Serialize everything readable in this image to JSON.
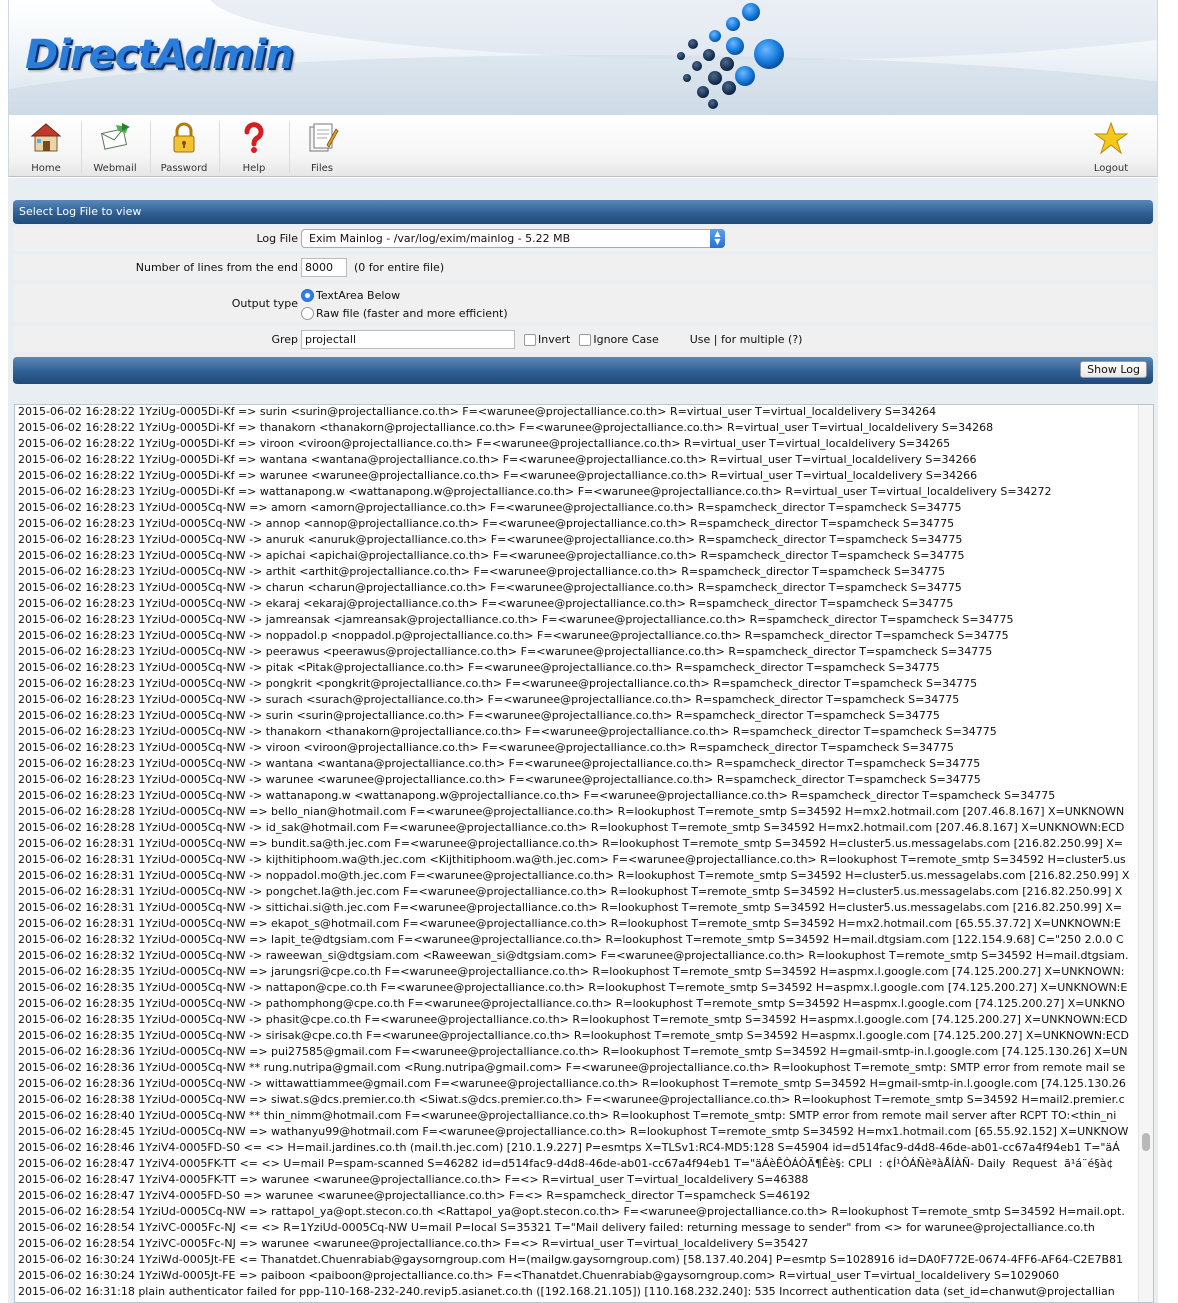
{
  "brand": {
    "name": "DirectAdmin"
  },
  "toolbar": {
    "home": "Home",
    "webmail": "Webmail",
    "password": "Password",
    "help": "Help",
    "files": "Files",
    "logout": "Logout"
  },
  "section": {
    "title": "Select Log File to view"
  },
  "form": {
    "log_file_label": "Log File",
    "log_file_value": "Exim Mainlog - /var/log/exim/mainlog - 5.22 MB",
    "lines_label": "Number of lines from the end",
    "lines_value": "8000",
    "lines_hint": "(0 for entire file)",
    "output_label": "Output type",
    "output_opt1": "TextArea Below",
    "output_opt2": "Raw file (faster and more efficient)",
    "output_selected": "TextArea Below",
    "grep_label": "Grep",
    "grep_value": "projectall",
    "invert_label": "Invert",
    "ignore_case_label": "Ignore Case",
    "use_hint": "Use | for multiple (?)",
    "show_log_button": "Show Log"
  },
  "colors": {
    "accent": "#2f5f93",
    "logo": "#2a7dd8",
    "panel": "#e9eef3"
  },
  "log_lines": [
    "2015-06-02 16:28:22 1YziUg-0005Di-Kf => surin <surin@projectalliance.co.th> F=<warunee@projectalliance.co.th> R=virtual_user T=virtual_localdelivery S=34264",
    "2015-06-02 16:28:22 1YziUg-0005Di-Kf => thanakorn <thanakorn@projectalliance.co.th> F=<warunee@projectalliance.co.th> R=virtual_user T=virtual_localdelivery S=34268",
    "2015-06-02 16:28:22 1YziUg-0005Di-Kf => viroon <viroon@projectalliance.co.th> F=<warunee@projectalliance.co.th> R=virtual_user T=virtual_localdelivery S=34265",
    "2015-06-02 16:28:22 1YziUg-0005Di-Kf => wantana <wantana@projectalliance.co.th> F=<warunee@projectalliance.co.th> R=virtual_user T=virtual_localdelivery S=34266",
    "2015-06-02 16:28:22 1YziUg-0005Di-Kf => warunee <warunee@projectalliance.co.th> F=<warunee@projectalliance.co.th> R=virtual_user T=virtual_localdelivery S=34266",
    "2015-06-02 16:28:23 1YziUg-0005Di-Kf => wattanapong.w <wattanapong.w@projectalliance.co.th> F=<warunee@projectalliance.co.th> R=virtual_user T=virtual_localdelivery S=34272",
    "2015-06-02 16:28:23 1YziUd-0005Cq-NW => amorn <amorn@projectalliance.co.th> F=<warunee@projectalliance.co.th> R=spamcheck_director T=spamcheck S=34775",
    "2015-06-02 16:28:23 1YziUd-0005Cq-NW -> annop <annop@projectalliance.co.th> F=<warunee@projectalliance.co.th> R=spamcheck_director T=spamcheck S=34775",
    "2015-06-02 16:28:23 1YziUd-0005Cq-NW -> anuruk <anuruk@projectalliance.co.th> F=<warunee@projectalliance.co.th> R=spamcheck_director T=spamcheck S=34775",
    "2015-06-02 16:28:23 1YziUd-0005Cq-NW -> apichai <apichai@projectalliance.co.th> F=<warunee@projectalliance.co.th> R=spamcheck_director T=spamcheck S=34775",
    "2015-06-02 16:28:23 1YziUd-0005Cq-NW -> arthit <arthit@projectalliance.co.th> F=<warunee@projectalliance.co.th> R=spamcheck_director T=spamcheck S=34775",
    "2015-06-02 16:28:23 1YziUd-0005Cq-NW -> charun <charun@projectalliance.co.th> F=<warunee@projectalliance.co.th> R=spamcheck_director T=spamcheck S=34775",
    "2015-06-02 16:28:23 1YziUd-0005Cq-NW -> ekaraj <ekaraj@projectalliance.co.th> F=<warunee@projectalliance.co.th> R=spamcheck_director T=spamcheck S=34775",
    "2015-06-02 16:28:23 1YziUd-0005Cq-NW -> jamreansak <jamreansak@projectalliance.co.th> F=<warunee@projectalliance.co.th> R=spamcheck_director T=spamcheck S=34775",
    "2015-06-02 16:28:23 1YziUd-0005Cq-NW -> noppadol.p <noppadol.p@projectalliance.co.th> F=<warunee@projectalliance.co.th> R=spamcheck_director T=spamcheck S=34775",
    "2015-06-02 16:28:23 1YziUd-0005Cq-NW -> peerawus <peerawus@projectalliance.co.th> F=<warunee@projectalliance.co.th> R=spamcheck_director T=spamcheck S=34775",
    "2015-06-02 16:28:23 1YziUd-0005Cq-NW -> pitak <Pitak@projectalliance.co.th> F=<warunee@projectalliance.co.th> R=spamcheck_director T=spamcheck S=34775",
    "2015-06-02 16:28:23 1YziUd-0005Cq-NW -> pongkrit <pongkrit@projectalliance.co.th> F=<warunee@projectalliance.co.th> R=spamcheck_director T=spamcheck S=34775",
    "2015-06-02 16:28:23 1YziUd-0005Cq-NW -> surach <surach@projectalliance.co.th> F=<warunee@projectalliance.co.th> R=spamcheck_director T=spamcheck S=34775",
    "2015-06-02 16:28:23 1YziUd-0005Cq-NW -> surin <surin@projectalliance.co.th> F=<warunee@projectalliance.co.th> R=spamcheck_director T=spamcheck S=34775",
    "2015-06-02 16:28:23 1YziUd-0005Cq-NW -> thanakorn <thanakorn@projectalliance.co.th> F=<warunee@projectalliance.co.th> R=spamcheck_director T=spamcheck S=34775",
    "2015-06-02 16:28:23 1YziUd-0005Cq-NW -> viroon <viroon@projectalliance.co.th> F=<warunee@projectalliance.co.th> R=spamcheck_director T=spamcheck S=34775",
    "2015-06-02 16:28:23 1YziUd-0005Cq-NW -> wantana <wantana@projectalliance.co.th> F=<warunee@projectalliance.co.th> R=spamcheck_director T=spamcheck S=34775",
    "2015-06-02 16:28:23 1YziUd-0005Cq-NW -> warunee <warunee@projectalliance.co.th> F=<warunee@projectalliance.co.th> R=spamcheck_director T=spamcheck S=34775",
    "2015-06-02 16:28:23 1YziUd-0005Cq-NW -> wattanapong.w <wattanapong.w@projectalliance.co.th> F=<warunee@projectalliance.co.th> R=spamcheck_director T=spamcheck S=34775",
    "2015-06-02 16:28:28 1YziUd-0005Cq-NW => bello_nian@hotmail.com F=<warunee@projectalliance.co.th> R=lookuphost T=remote_smtp S=34592 H=mx2.hotmail.com [207.46.8.167] X=UNKNOWN",
    "2015-06-02 16:28:28 1YziUd-0005Cq-NW -> id_sak@hotmail.com F=<warunee@projectalliance.co.th> R=lookuphost T=remote_smtp S=34592 H=mx2.hotmail.com [207.46.8.167] X=UNKNOWN:ECD",
    "2015-06-02 16:28:31 1YziUd-0005Cq-NW => bundit.sa@th.jec.com F=<warunee@projectalliance.co.th> R=lookuphost T=remote_smtp S=34592 H=cluster5.us.messagelabs.com [216.82.250.99] X=",
    "2015-06-02 16:28:31 1YziUd-0005Cq-NW -> kijthitiphoom.wa@th.jec.com <Kijthitiphoom.wa@th.jec.com> F=<warunee@projectalliance.co.th> R=lookuphost T=remote_smtp S=34592 H=cluster5.us",
    "2015-06-02 16:28:31 1YziUd-0005Cq-NW -> noppadol.mo@th.jec.com F=<warunee@projectalliance.co.th> R=lookuphost T=remote_smtp S=34592 H=cluster5.us.messagelabs.com [216.82.250.99] X",
    "2015-06-02 16:28:31 1YziUd-0005Cq-NW -> pongchet.la@th.jec.com F=<warunee@projectalliance.co.th> R=lookuphost T=remote_smtp S=34592 H=cluster5.us.messagelabs.com [216.82.250.99] X",
    "2015-06-02 16:28:31 1YziUd-0005Cq-NW -> sittichai.si@th.jec.com F=<warunee@projectalliance.co.th> R=lookuphost T=remote_smtp S=34592 H=cluster5.us.messagelabs.com [216.82.250.99] X=",
    "2015-06-02 16:28:31 1YziUd-0005Cq-NW => ekapot_s@hotmail.com F=<warunee@projectalliance.co.th> R=lookuphost T=remote_smtp S=34592 H=mx2.hotmail.com [65.55.37.72] X=UNKNOWN:E",
    "2015-06-02 16:28:32 1YziUd-0005Cq-NW => lapit_te@dtgsiam.com F=<warunee@projectalliance.co.th> R=lookuphost T=remote_smtp S=34592 H=mail.dtgsiam.com [122.154.9.68] C=\"250 2.0.0 C",
    "2015-06-02 16:28:32 1YziUd-0005Cq-NW -> raweewan_si@dtgsiam.com <Raweewan_si@dtgsiam.com> F=<warunee@projectalliance.co.th> R=lookuphost T=remote_smtp S=34592 H=mail.dtgsiam.",
    "2015-06-02 16:28:35 1YziUd-0005Cq-NW => jarungsri@cpe.co.th F=<warunee@projectalliance.co.th> R=lookuphost T=remote_smtp S=34592 H=aspmx.l.google.com [74.125.200.27] X=UNKNOWN:",
    "2015-06-02 16:28:35 1YziUd-0005Cq-NW -> nattapon@cpe.co.th F=<warunee@projectalliance.co.th> R=lookuphost T=remote_smtp S=34592 H=aspmx.l.google.com [74.125.200.27] X=UNKNOWN:E",
    "2015-06-02 16:28:35 1YziUd-0005Cq-NW -> pathomphong@cpe.co.th F=<warunee@projectalliance.co.th> R=lookuphost T=remote_smtp S=34592 H=aspmx.l.google.com [74.125.200.27] X=UNKNO",
    "2015-06-02 16:28:35 1YziUd-0005Cq-NW -> phasit@cpe.co.th F=<warunee@projectalliance.co.th> R=lookuphost T=remote_smtp S=34592 H=aspmx.l.google.com [74.125.200.27] X=UNKNOWN:ECD",
    "2015-06-02 16:28:35 1YziUd-0005Cq-NW -> sirisak@cpe.co.th F=<warunee@projectalliance.co.th> R=lookuphost T=remote_smtp S=34592 H=aspmx.l.google.com [74.125.200.27] X=UNKNOWN:ECD",
    "2015-06-02 16:28:36 1YziUd-0005Cq-NW => pui27585@gmail.com F=<warunee@projectalliance.co.th> R=lookuphost T=remote_smtp S=34592 H=gmail-smtp-in.l.google.com [74.125.130.26] X=UN",
    "2015-06-02 16:28:36 1YziUd-0005Cq-NW ** rung.nutripa@gmail.com <Rung.nutripa@gmail.com> F=<warunee@projectalliance.co.th> R=lookuphost T=remote_smtp: SMTP error from remote mail se",
    "2015-06-02 16:28:36 1YziUd-0005Cq-NW -> wittawattiammee@gmail.com F=<warunee@projectalliance.co.th> R=lookuphost T=remote_smtp S=34592 H=gmail-smtp-in.l.google.com [74.125.130.26",
    "2015-06-02 16:28:38 1YziUd-0005Cq-NW => siwat.s@dcs.premier.co.th <Siwat.s@dcs.premier.co.th> F=<warunee@projectalliance.co.th> R=lookuphost T=remote_smtp S=34592 H=mail2.premier.c",
    "2015-06-02 16:28:40 1YziUd-0005Cq-NW ** thin_nimm@hotmail.com F=<warunee@projectalliance.co.th> R=lookuphost T=remote_smtp: SMTP error from remote mail server after RCPT TO:<thin_ni",
    "2015-06-02 16:28:45 1YziUd-0005Cq-NW => wathanyu99@hotmail.com F=<warunee@projectalliance.co.th> R=lookuphost T=remote_smtp S=34592 H=mx1.hotmail.com [65.55.92.152] X=UNKNOW",
    "2015-06-02 16:28:46 1YziV4-0005FD-S0 <= <> H=mail.jardines.co.th (mail.th.jec.com) [210.1.9.227] P=esmtps X=TLSv1:RC4-MD5:128 S=45904 id=d514fac9-d4d8-46de-ab01-cc67a4f94eb1 T=\"äÁ",
    "2015-06-02 16:28:47 1YziV4-0005FK-TT <= <> U=mail P=spam-scanned S=46282 id=d514fac9-d4d8-46de-ab01-cc67a4f94eb1 T=\"äÁèÊÒÁÒÃ¶Êè§: CPLI  : ¢Í¹ÔÁÑèªàÅÍÀÑ- Daily  Request  ã¹á¨é§à¢",
    "2015-06-02 16:28:47 1YziV4-0005FK-TT => warunee <warunee@projectalliance.co.th> F=<> R=virtual_user T=virtual_localdelivery S=46388",
    "2015-06-02 16:28:47 1YziV4-0005FD-S0 => warunee <warunee@projectalliance.co.th> F=<> R=spamcheck_director T=spamcheck S=46192",
    "2015-06-02 16:28:54 1YziUd-0005Cq-NW => rattapol_ya@opt.stecon.co.th <Rattapol_ya@opt.stecon.co.th> F=<warunee@projectalliance.co.th> R=lookuphost T=remote_smtp S=34592 H=mail.opt.",
    "2015-06-02 16:28:54 1YziVC-0005Fc-NJ <= <> R=1YziUd-0005Cq-NW U=mail P=local S=35321 T=\"Mail delivery failed: returning message to sender\" from <> for warunee@projectalliance.co.th",
    "2015-06-02 16:28:54 1YziVC-0005Fc-NJ => warunee <warunee@projectalliance.co.th> F=<> R=virtual_user T=virtual_localdelivery S=35427",
    "2015-06-02 16:30:24 1YziWd-0005Jt-FE <= Thanatdet.Chuenrabiab@gaysorngroup.com H=(mailgw.gaysorngroup.com) [58.137.40.204] P=esmtp S=1028916 id=DA0F772E-0674-4FF6-AF64-C2E7B81",
    "2015-06-02 16:30:24 1YziWd-0005Jt-FE => paiboon <paiboon@projectalliance.co.th> F=<Thanatdet.Chuenrabiab@gaysorngroup.com> R=virtual_user T=virtual_localdelivery S=1029060",
    "2015-06-02 16:31:18 plain authenticator failed for ppp-110-168-232-240.revip5.asianet.co.th ([192.168.21.105]) [110.168.232.240]: 535 Incorrect authentication data (set_id=chanwut@projectallian"
  ]
}
